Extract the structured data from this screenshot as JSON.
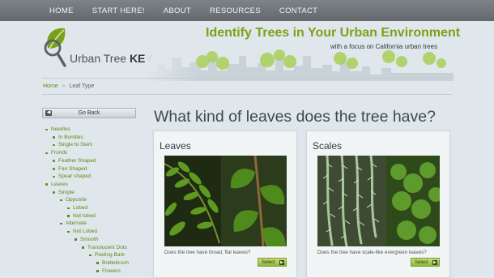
{
  "nav": {
    "items": [
      "HOME",
      "START HERE!",
      "ABOUT",
      "RESOURCES",
      "CONTACT"
    ]
  },
  "header": {
    "logo_text_a": "Urban Tree ",
    "logo_text_b": "KEY",
    "headline": "Identify Trees in Your Urban Environment",
    "subline": "with a focus on California urban trees"
  },
  "breadcrumb": {
    "home": "Home",
    "current": "Leaf Type"
  },
  "sidebar": {
    "go_back": "Go Back",
    "tree": [
      {
        "label": "Needles",
        "level": 0
      },
      {
        "label": "In Bundles",
        "level": 1
      },
      {
        "label": "Single to Stem",
        "level": 1
      },
      {
        "label": "Fronds",
        "level": 0
      },
      {
        "label": "Feather Shaped",
        "level": 1
      },
      {
        "label": "Fan Shaped",
        "level": 1
      },
      {
        "label": "Spear shaped",
        "level": 1
      },
      {
        "label": "Leaves",
        "level": 0
      },
      {
        "label": "Simple",
        "level": 1
      },
      {
        "label": "Opposite",
        "level": 2
      },
      {
        "label": "Lobed",
        "level": 3
      },
      {
        "label": "Not lobed",
        "level": 3
      },
      {
        "label": "Alternate",
        "level": 2
      },
      {
        "label": "Not Lobed",
        "level": 3
      },
      {
        "label": "Smooth",
        "level": 4
      },
      {
        "label": "Translucent Dots",
        "level": 5
      },
      {
        "label": "Peeling Bark",
        "level": 6
      },
      {
        "label": "Bottlebrush",
        "level": 7
      },
      {
        "label": "Flowers",
        "level": 7
      }
    ]
  },
  "main": {
    "question": "What kind of leaves does the tree have?",
    "cards": [
      {
        "title": "Leaves",
        "question": "Does the tree have broad, flat leaves?",
        "select": "Select"
      },
      {
        "title": "Scales",
        "question": "Does the tree have scale-like evergreen leaves?",
        "select": "Select"
      }
    ]
  },
  "colors": {
    "accent": "#7ba11a",
    "link": "#5b8a16",
    "nav_bg": "#6e7478",
    "page_bg": "#dfe7ec"
  }
}
